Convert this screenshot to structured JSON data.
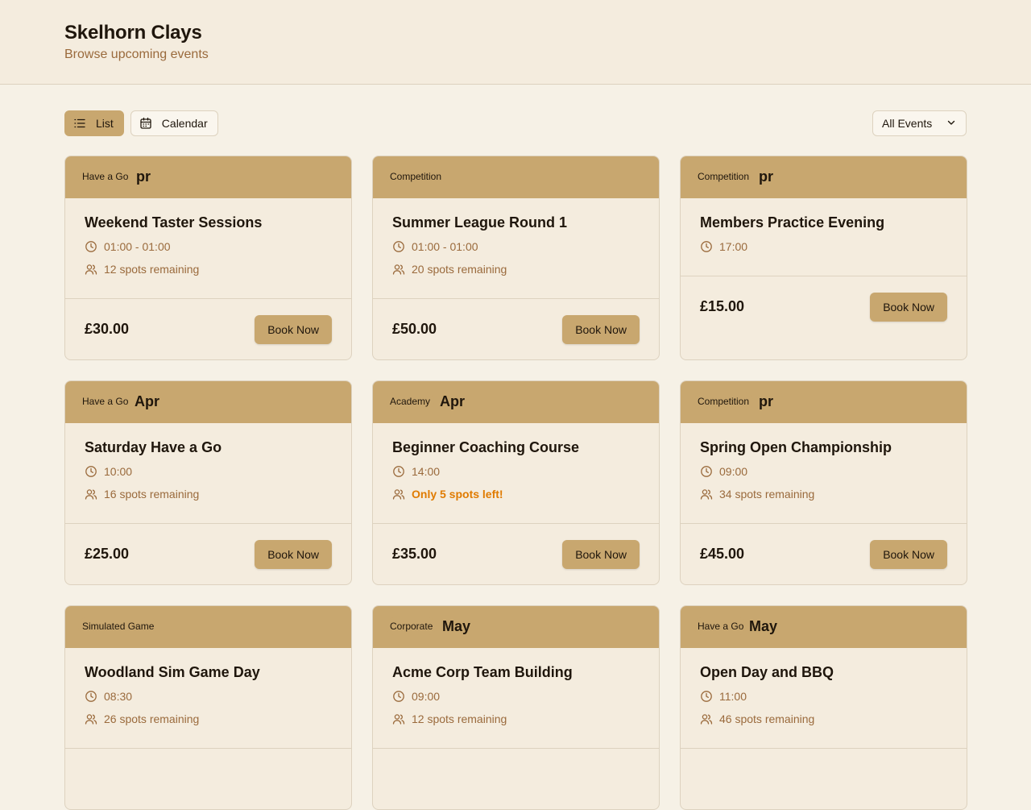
{
  "site": {
    "title": "Skelhorn Clays",
    "subtitle": "Browse upcoming events"
  },
  "toolbar": {
    "list_label": "List",
    "calendar_label": "Calendar",
    "filter_value": "All Events"
  },
  "events": [
    {
      "category": "Have a Go",
      "date_fragment": "pr",
      "title": "Weekend Taster Sessions",
      "time": "01:00 - 01:00",
      "spots": "12 spots remaining",
      "price": "£30.00",
      "cta": "Book Now"
    },
    {
      "category": "Competition",
      "date_fragment": "",
      "title": "Summer League Round 1",
      "time": "01:00 - 01:00",
      "spots": "20 spots remaining",
      "price": "£50.00",
      "cta": "Book Now"
    },
    {
      "category": "Competition",
      "date_fragment": "pr",
      "title": "Members Practice Evening",
      "time": "17:00",
      "spots": "",
      "price": "£15.00",
      "cta": "Book Now"
    },
    {
      "category": "Have a Go",
      "date_fragment": "Apr",
      "title": "Saturday Have a Go",
      "time": "10:00",
      "spots": "16 spots remaining",
      "price": "£25.00",
      "cta": "Book Now"
    },
    {
      "category": "Academy",
      "date_fragment": "Apr",
      "title": "Beginner Coaching Course",
      "time": "14:00",
      "spots": "Only 5 spots left!",
      "price": "£35.00",
      "cta": "Book Now"
    },
    {
      "category": "Competition",
      "date_fragment": "pr",
      "title": "Spring Open Championship",
      "time": "09:00",
      "spots": "34 spots remaining",
      "price": "£45.00",
      "cta": "Book Now"
    },
    {
      "category": "Simulated Game",
      "date_fragment": "",
      "title": "Woodland Sim Game Day",
      "time": "08:30",
      "spots": "26 spots remaining",
      "price": "",
      "cta": ""
    },
    {
      "category": "Corporate",
      "date_fragment": "May",
      "title": "Acme Corp Team Building",
      "time": "09:00",
      "spots": "12 spots remaining",
      "price": "",
      "cta": ""
    },
    {
      "category": "Have a Go",
      "date_fragment": "May",
      "title": "Open Day and BBQ",
      "time": "11:00",
      "spots": "46 spots remaining",
      "price": "",
      "cta": ""
    }
  ],
  "colors": {
    "accent": "#c8a76f",
    "warning": "#e07b00",
    "muted": "#9a6a3c"
  }
}
